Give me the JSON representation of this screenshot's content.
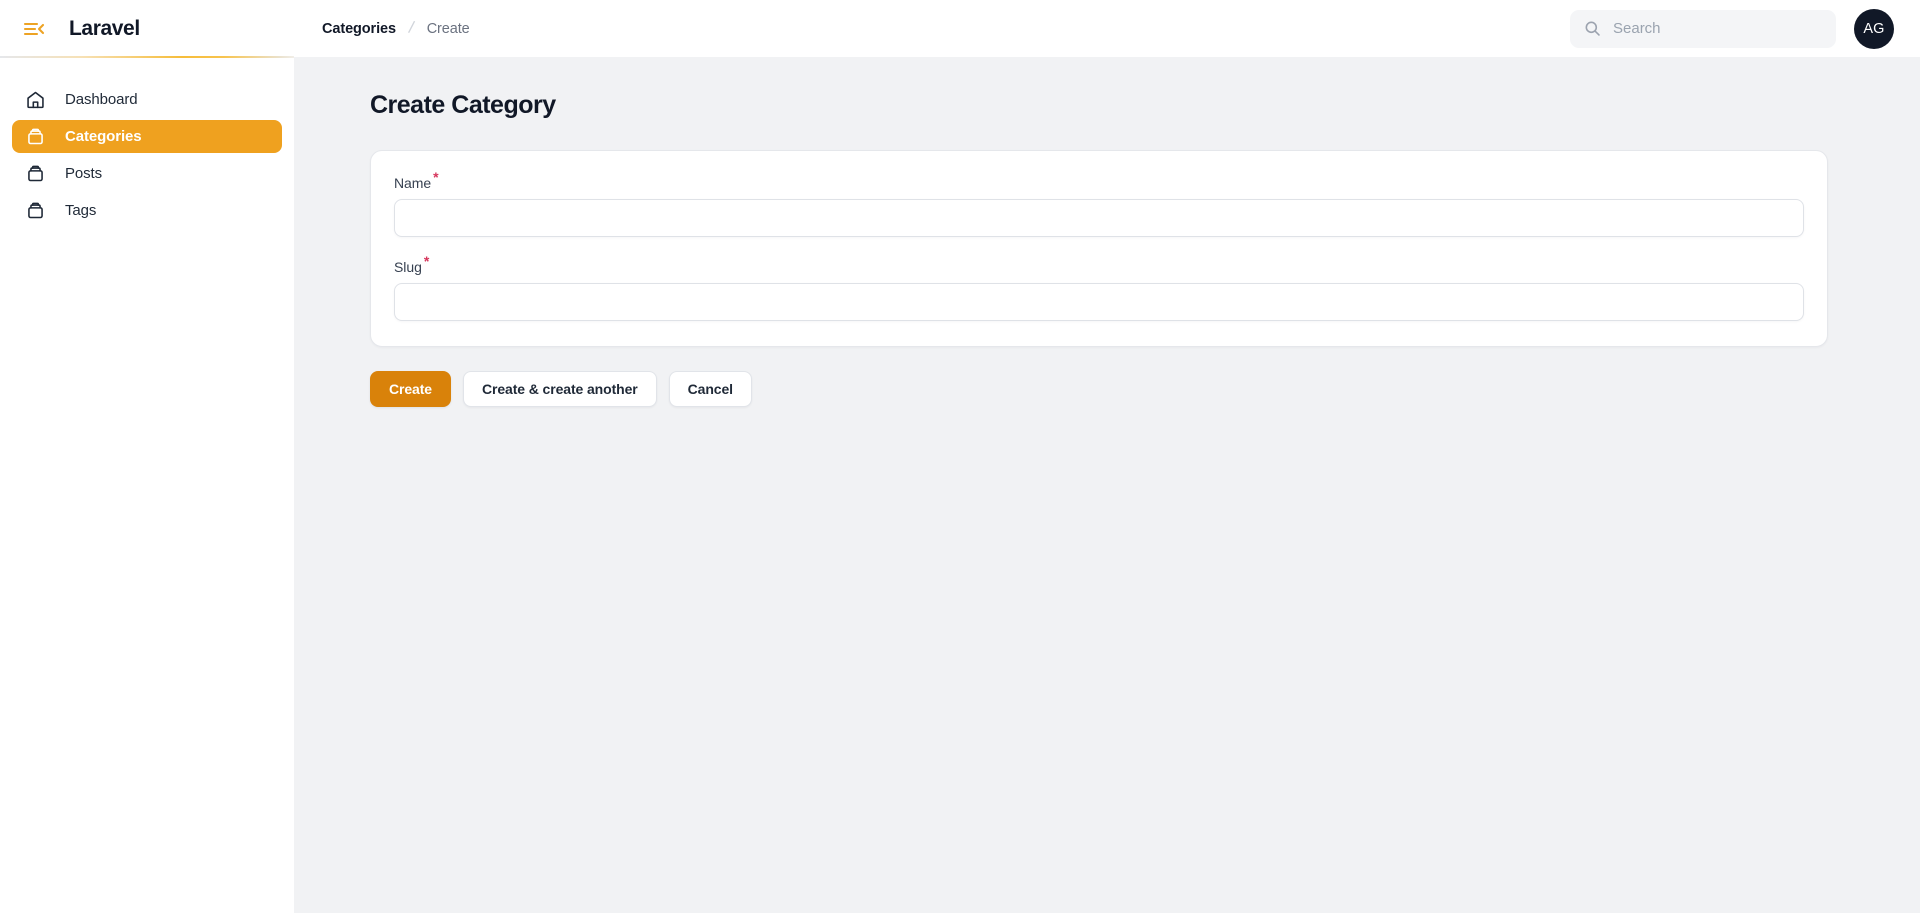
{
  "sidebar": {
    "collapse_icon": "bars-arrow-left-icon",
    "brand": "Laravel",
    "accent_color": "#efa11f",
    "items": [
      {
        "label": "Dashboard",
        "icon": "home-icon",
        "active": false
      },
      {
        "label": "Categories",
        "icon": "archive-box-icon",
        "active": true
      },
      {
        "label": "Posts",
        "icon": "archive-box-icon",
        "active": false
      },
      {
        "label": "Tags",
        "icon": "archive-box-icon",
        "active": false
      }
    ]
  },
  "topbar": {
    "breadcrumb": {
      "parent": "Categories",
      "separator": "/",
      "current": "Create"
    },
    "search": {
      "icon": "search-icon",
      "value": "",
      "placeholder": "Search"
    },
    "avatar": {
      "initials": "AG",
      "background": "#111827"
    }
  },
  "main": {
    "page_title": "Create Category",
    "form": {
      "fields": [
        {
          "label": "Name",
          "required": true,
          "required_marker": "*",
          "value": "",
          "placeholder": ""
        },
        {
          "label": "Slug",
          "required": true,
          "required_marker": "*",
          "value": "",
          "placeholder": ""
        }
      ]
    },
    "actions": [
      {
        "label": "Create",
        "style": "primary"
      },
      {
        "label": "Create & create another",
        "style": "secondary"
      },
      {
        "label": "Cancel",
        "style": "secondary"
      }
    ]
  },
  "colors": {
    "page_background": "#f1f2f4",
    "surface": "#ffffff",
    "primary": "#d9820a",
    "sidebar_active": "#efa11f",
    "required": "#d6365c",
    "text": "#111827",
    "muted_text": "#6b7280"
  }
}
